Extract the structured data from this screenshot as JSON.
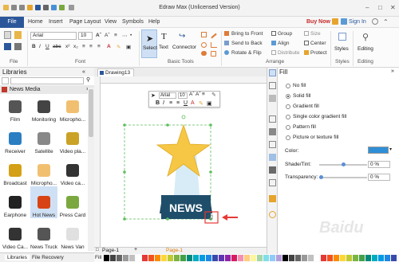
{
  "app": {
    "title": "Edraw Max (Unlicensed Version)"
  },
  "menu": {
    "file": "File",
    "items": [
      "Home",
      "Insert",
      "Page Layout",
      "View",
      "Symbols",
      "Help"
    ],
    "buy_now": "Buy Now",
    "sign_in": "Sign In"
  },
  "ribbon": {
    "font_name": "Arial",
    "font_size": "10",
    "groups": {
      "file": "File",
      "font": "Font",
      "basic_tools": "Basic Tools",
      "arrange": "Arrange",
      "styles": "Styles",
      "editing": "Editing"
    },
    "tools": {
      "select": "Select",
      "text": "Text",
      "connector": "Connector"
    },
    "arrange": {
      "bring_to_front": "Bring to Front",
      "send_to_back": "Send to Back",
      "rotate_flip": "Rotate & Flip",
      "group": "Group",
      "align": "Align",
      "distribute": "Distribute",
      "size": "Size",
      "center": "Center",
      "protect": "Protect"
    },
    "styles_label": "Styles",
    "editing_label": "Editing"
  },
  "libraries": {
    "title": "Libraries",
    "section": "News Media",
    "items": [
      {
        "label": "Film",
        "icon": "film-icon"
      },
      {
        "label": "Monitoring",
        "icon": "monitoring-icon"
      },
      {
        "label": "Micropho...",
        "icon": "microphone-icon"
      },
      {
        "label": "Receiver",
        "icon": "receiver-icon"
      },
      {
        "label": "Satellite",
        "icon": "satellite-icon"
      },
      {
        "label": "Video pla...",
        "icon": "video-player-icon"
      },
      {
        "label": "Broadcast",
        "icon": "broadcast-icon"
      },
      {
        "label": "Micropho...",
        "icon": "microphone-icon"
      },
      {
        "label": "Video ca...",
        "icon": "video-camera-icon"
      },
      {
        "label": "Earphone",
        "icon": "earphone-icon"
      },
      {
        "label": "Hot News",
        "icon": "hot-news-icon"
      },
      {
        "label": "Press Card",
        "icon": "press-card-icon"
      },
      {
        "label": "Video Ca...",
        "icon": "video-camera-icon"
      },
      {
        "label": "News Truck",
        "icon": "news-truck-icon"
      },
      {
        "label": "News Van",
        "icon": "news-van-icon"
      }
    ]
  },
  "bottom_tabs": {
    "libraries": "Libraries",
    "file_recovery": "File Recovery"
  },
  "document": {
    "tab": "Drawing13",
    "shape_text": "NEWS",
    "page_tab_inactive": "Page-1",
    "page_tab_active": "Page-1",
    "fill_label": "Fill"
  },
  "floating_toolbar": {
    "font": "Arial",
    "size": "10"
  },
  "fill_panel": {
    "title": "Fill",
    "options": [
      {
        "label": "No fill",
        "selected": false
      },
      {
        "label": "Solid fill",
        "selected": true
      },
      {
        "label": "Gradient fill",
        "selected": false
      },
      {
        "label": "Single color gradient fill",
        "selected": false
      },
      {
        "label": "Pattern fill",
        "selected": false
      },
      {
        "label": "Picture or texture fill",
        "selected": false
      }
    ],
    "color_label": "Color:",
    "color_value": "#2e8fd6",
    "shade_label": "Shade/Tint:",
    "shade_value": "0 %",
    "shade_fraction": 0.5,
    "transparency_label": "Transparency:",
    "transparency_value": "0 %",
    "transparency_fraction": 0
  },
  "colors": {
    "accent": "#2b579a",
    "star": "#f6c744",
    "banner": "#1f4e6b",
    "highlight": "#e53935"
  },
  "watermark": "Baidu"
}
